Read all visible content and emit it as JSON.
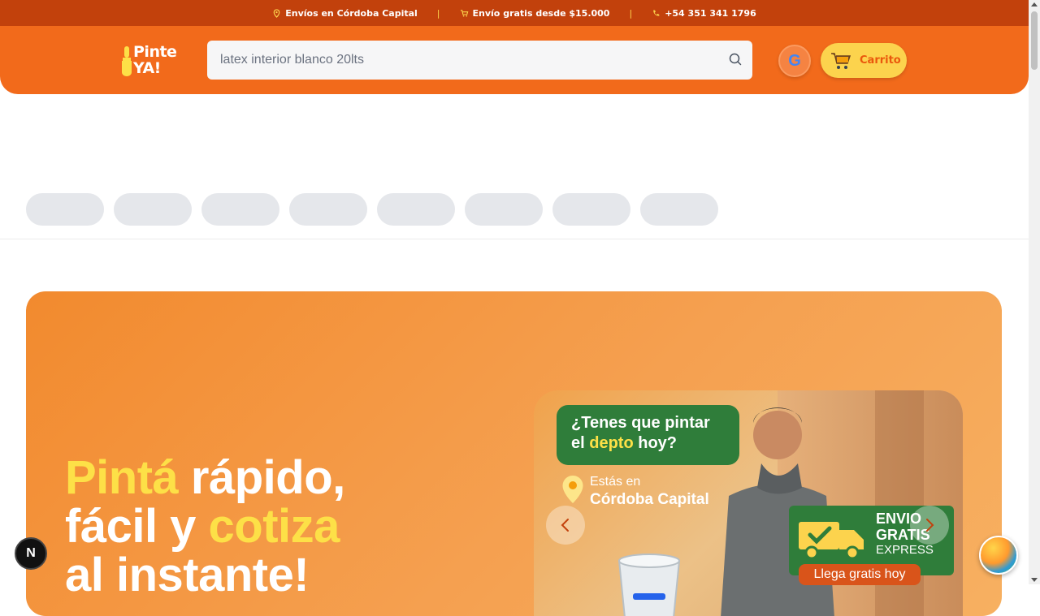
{
  "topbar": {
    "shipping_area": "Envíos en Córdoba Capital",
    "free_shipping": "Envío gratis desde $15.000",
    "phone": "+54 351 341 1796",
    "icons": [
      "location-pin-icon",
      "cart-icon",
      "phone-icon"
    ]
  },
  "header": {
    "logo_line1": "Pinte",
    "logo_line2": "YA!",
    "search": {
      "value": "latex interior blanco 20lts",
      "icon": "search-icon"
    },
    "google_icon_letter": "G",
    "cart_label": "Carrito"
  },
  "category_pills_count": 8,
  "hero": {
    "title_part1": "Pintá",
    "title_part2": " rápido,",
    "title_part3": "fácil y ",
    "title_part4": "cotiza",
    "title_part5": "al instante!",
    "banner": {
      "question_line1": "¿Tenes que pintar",
      "question_line2_a": "el ",
      "question_line2_b": "depto",
      "question_line2_c": " hoy?",
      "location_label": "Estás en",
      "location_value": "Córdoba Capital",
      "envio_line1": "ENVIO",
      "envio_line2": "GRATIS",
      "envio_line3": "EXPRESS",
      "llega": "Llega gratis hoy"
    }
  },
  "n_badge": "N",
  "colors": {
    "topbar_bg": "#c2410c",
    "header_bg": "#f26a1b",
    "accent_yellow": "#fcd34d",
    "hero_highlight": "#fde047",
    "banner_green": "#2f7d3a"
  }
}
